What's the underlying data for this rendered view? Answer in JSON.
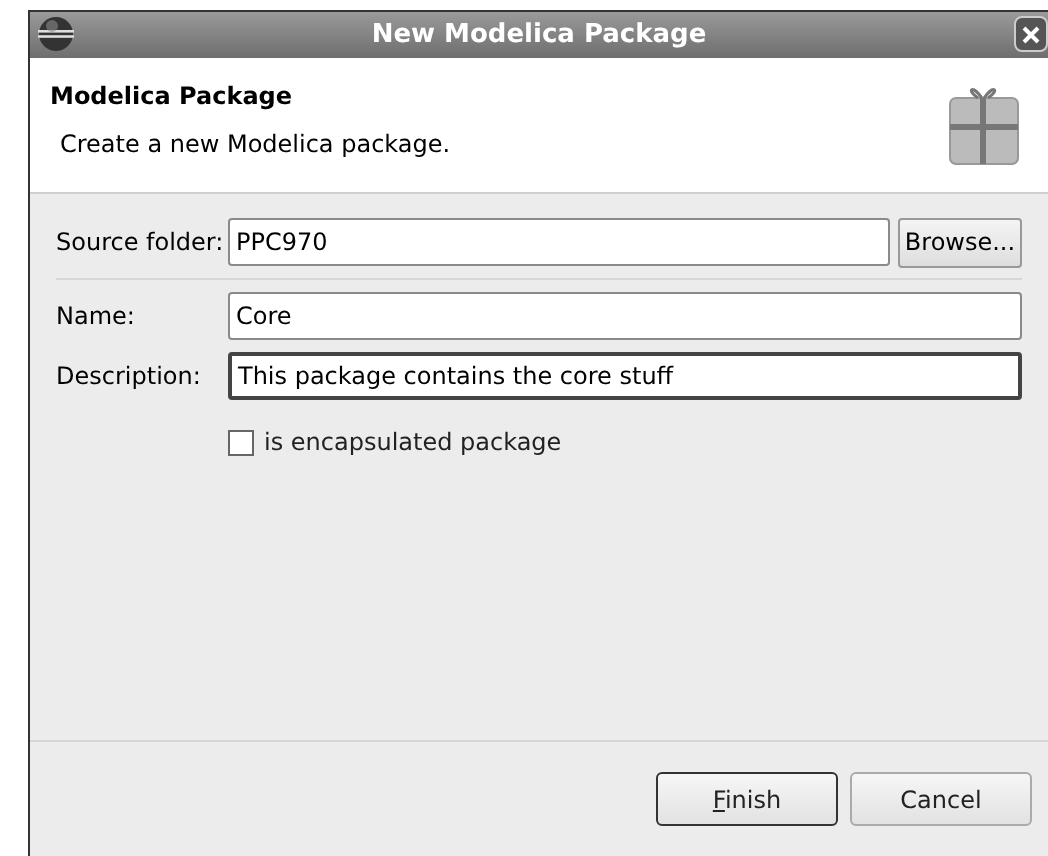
{
  "window": {
    "title": "New Modelica Package"
  },
  "header": {
    "title": "Modelica Package",
    "description": "Create a new Modelica package."
  },
  "source_folder": {
    "label": "Source folder:",
    "value": "PPC970",
    "button": "Browse..."
  },
  "fields": [
    {
      "label": "Name:",
      "value": "Core",
      "focused": false
    },
    {
      "label": "Description:",
      "value": "This package contains the core stuff",
      "focused": true
    }
  ],
  "checkbox": {
    "label": "is encapsulated package",
    "checked": false
  },
  "buttons": [
    {
      "label": "Finish",
      "default": true
    },
    {
      "label": "Cancel",
      "default": false
    }
  ]
}
